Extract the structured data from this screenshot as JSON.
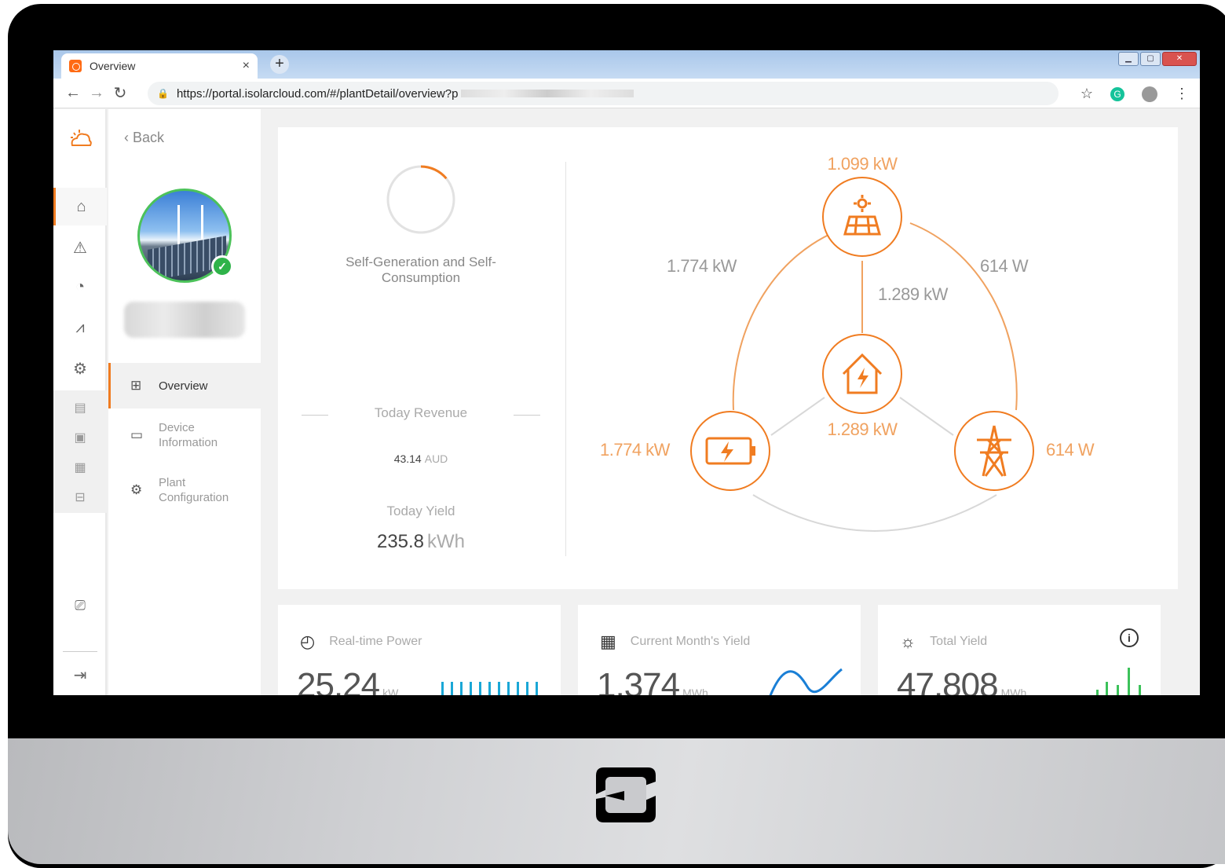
{
  "browser": {
    "tab_title": "Overview",
    "tab_close": "×",
    "new_tab": "+",
    "url": "https://portal.isolarcloud.com/#/plantDetail/overview?p"
  },
  "sidebar": {
    "back_label": "Back",
    "items": [
      {
        "label": "Overview",
        "icon": "grid-icon"
      },
      {
        "label": "Device Information",
        "icon": "folder-icon"
      },
      {
        "label": "Plant Configuration",
        "icon": "settings-icon"
      }
    ]
  },
  "overview": {
    "self_gen_label": "Self-Generation and Self-Consumption",
    "self_gen_progress": 0.14,
    "today_revenue_label": "Today Revenue",
    "today_revenue_value": "43.14",
    "today_revenue_unit": "AUD",
    "today_yield_label": "Today Yield",
    "today_yield_value": "235.8",
    "today_yield_unit": "kWh"
  },
  "energy_flow": {
    "pv_power": "1.099 kW",
    "pv_to_battery": "1.774 kW",
    "pv_to_grid": "614 W",
    "pv_to_load": "1.289 kW",
    "load_power": "1.289 kW",
    "battery_power": "1.774 kW",
    "grid_power": "614 W"
  },
  "stats": [
    {
      "label": "Real-time Power",
      "value": "25.24",
      "unit": "kW",
      "icon": "gauge-icon",
      "accent": "#1aa7d6"
    },
    {
      "label": "Current Month's Yield",
      "value": "1,374",
      "unit": "MWh",
      "icon": "calendar-icon",
      "accent": "#1a7fd6"
    },
    {
      "label": "Total Yield",
      "value": "47,808",
      "unit": "MWh",
      "icon": "solar-sun-icon",
      "accent": "#3cc25a"
    }
  ],
  "colors": {
    "accent": "#f07c21",
    "success": "#2fb34a"
  }
}
